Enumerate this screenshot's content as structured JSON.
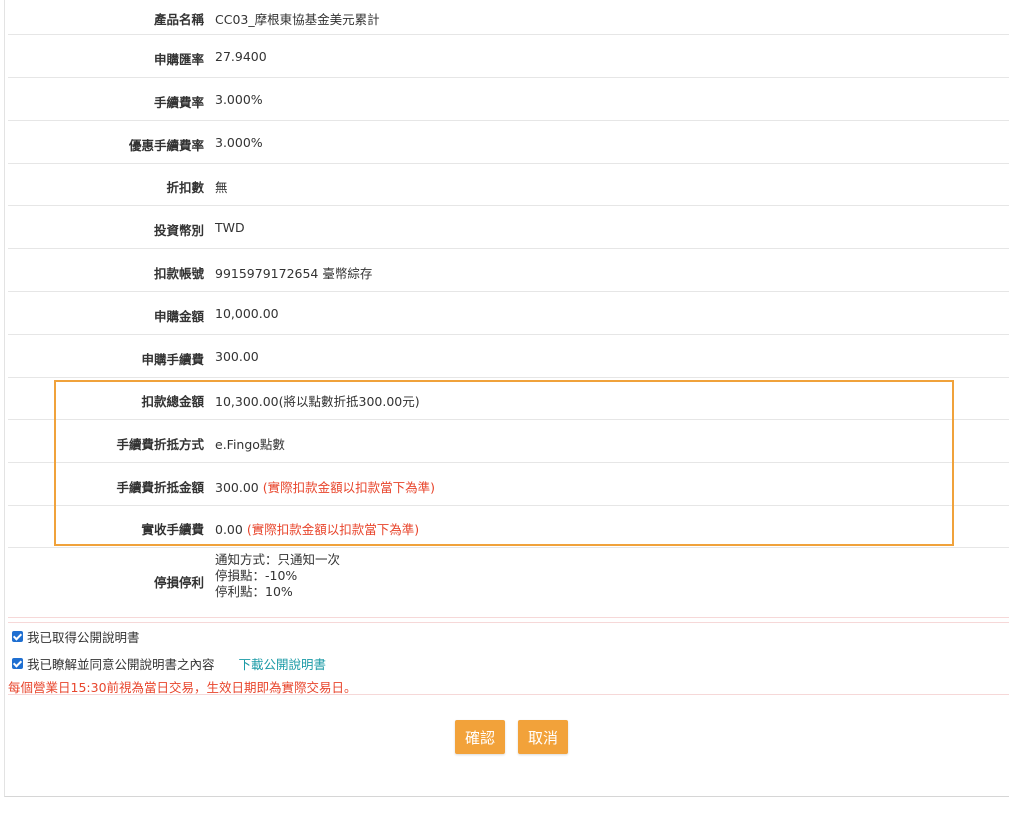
{
  "rows": [
    {
      "label": "產品名稱",
      "value": "CC03_摩根東協基金美元累計"
    },
    {
      "label": "申購匯率",
      "value": "27.9400"
    },
    {
      "label": "手續費率",
      "value": "3.000%"
    },
    {
      "label": "優惠手續費率",
      "value": "3.000%"
    },
    {
      "label": "折扣數",
      "value": "無"
    },
    {
      "label": "投資幣別",
      "value": "TWD"
    },
    {
      "label": "扣款帳號",
      "value": "9915979172654 臺幣綜存"
    },
    {
      "label": "申購金額",
      "value": "10,000.00"
    },
    {
      "label": "申購手續費",
      "value": "300.00"
    },
    {
      "label": "扣款總金額",
      "value": "10,300.00(將以點數折抵300.00元)"
    },
    {
      "label": "手續費折抵方式",
      "value": "e.Fingo點數"
    },
    {
      "label": "手續費折抵金額",
      "value": "300.00",
      "note": "(實際扣款金額以扣款當下為準)"
    },
    {
      "label": "實收手續費",
      "value": "0.00",
      "note": "(實際扣款金額以扣款當下為準)"
    }
  ],
  "stop": {
    "label": "停損停利",
    "lines": [
      "通知方式：只通知一次",
      "停損點：-10%",
      "停利點：10%"
    ]
  },
  "checks": {
    "prospectus_received": "我已取得公開說明書",
    "prospectus_agree": "我已瞭解並同意公開說明書之內容",
    "download_link": "下載公開說明書"
  },
  "notice": "每個營業日15:30前視為當日交易，生效日期即為實際交易日。",
  "buttons": {
    "confirm": "確認",
    "cancel": "取消"
  },
  "colors": {
    "accent": "#f2a23a",
    "highlight_border": "#f0a23b",
    "warning": "#e8452c",
    "link": "#1a9aa6"
  }
}
